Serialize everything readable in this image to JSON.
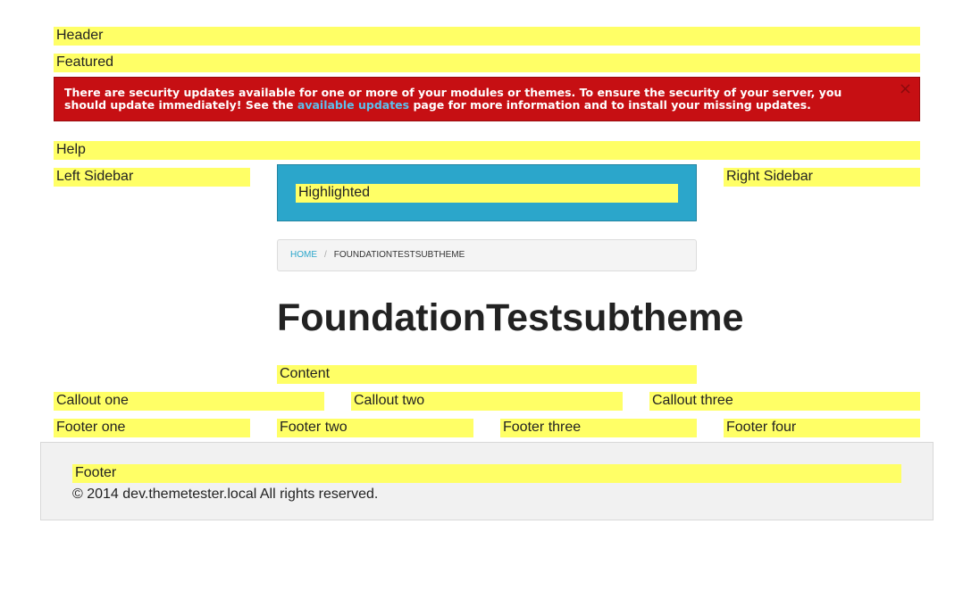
{
  "regions": {
    "header": "Header",
    "featured": "Featured",
    "help": "Help",
    "left_sidebar": "Left Sidebar",
    "highlighted": "Highlighted",
    "right_sidebar": "Right Sidebar",
    "content": "Content",
    "callout_one": "Callout one",
    "callout_two": "Callout two",
    "callout_three": "Callout three",
    "footer_one": "Footer one",
    "footer_two": "Footer two",
    "footer_three": "Footer three",
    "footer_four": "Footer four",
    "footer": "Footer"
  },
  "alert": {
    "text_before": "There are security updates available for one or more of your modules or themes. To ensure the security of your server, you should update immediately! See the ",
    "link_text": "available updates",
    "text_after": " page for more information and to install your missing updates.",
    "close_label": "×"
  },
  "breadcrumb": {
    "home": "HOME",
    "separator": "/",
    "current": "FOUNDATIONTESTSUBTHEME"
  },
  "page_title": "FoundationTestsubtheme",
  "copyright": "© 2014 dev.themetester.local All rights reserved."
}
